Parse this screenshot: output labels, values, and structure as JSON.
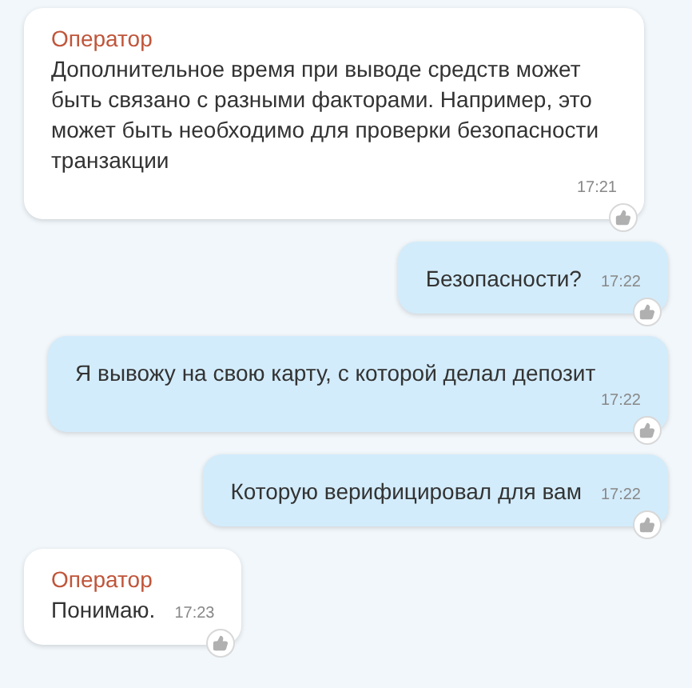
{
  "messages": [
    {
      "kind": "incoming",
      "sender": "Оператор",
      "text": "Дополнительное время при выводе средств может быть связано с разными факторами. Например, это может быть необходимо для проверки безопасности транзакции",
      "time": "17:21"
    },
    {
      "kind": "outgoing",
      "text": "Безопасности?",
      "time": "17:22"
    },
    {
      "kind": "outgoing",
      "text": "Я вывожу на свою карту, с которой делал депозит",
      "time": "17:22"
    },
    {
      "kind": "outgoing",
      "text": "Которую верифицировал для вам",
      "time": "17:22"
    },
    {
      "kind": "incoming",
      "sender": "Оператор",
      "text": "Понимаю.",
      "time": "17:23"
    }
  ]
}
